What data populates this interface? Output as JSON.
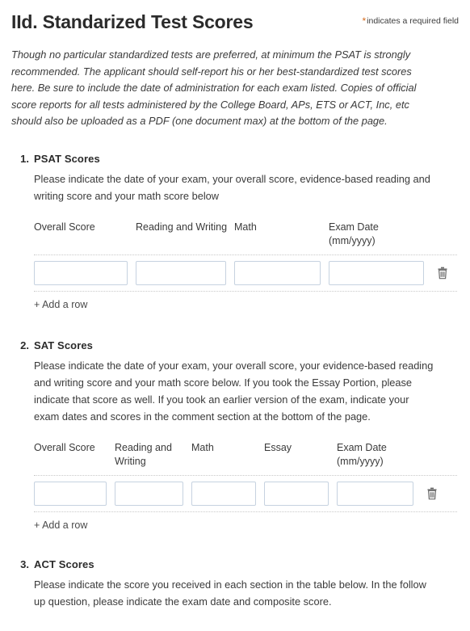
{
  "header": {
    "title": "IId. Standarized Test Scores",
    "required_note_star": "*",
    "required_note_text": "indicates a required field"
  },
  "intro": "Though no particular standardized tests are preferred, at minimum the PSAT is strongly recommended. The applicant should self-report his or her best-standardized test scores here. Be sure to include the date of administration for each exam listed. Copies of official score reports for all tests administered by the College Board, APs, ETS or ACT, Inc, etc should also be uploaded as a PDF (one document max) at the bottom of the page.",
  "questions": [
    {
      "number": "1.",
      "title": "PSAT Scores",
      "description": "Please indicate the date of your exam, your overall score, evidence-based reading and writing score and your math score below",
      "columns": [
        "Overall Score",
        "Reading and Writing",
        "Math",
        "Exam Date (mm/yyyy)"
      ],
      "row_values": [
        "",
        "",
        "",
        ""
      ],
      "delete_icon": "trash-icon",
      "add_row_label": "+ Add a row"
    },
    {
      "number": "2.",
      "title": "SAT Scores",
      "description": "Please indicate the date of your exam, your overall score, your evidence-based reading and writing score and your math score below. If you took the Essay Portion, please indicate that score as well. If you took an earlier version of the exam, indicate your exam dates and scores in the comment section at the bottom of the page.",
      "columns": [
        "Overall Score",
        "Reading and Writing",
        "Math",
        "Essay",
        "Exam Date (mm/yyyy)"
      ],
      "row_values": [
        "",
        "",
        "",
        "",
        ""
      ],
      "delete_icon": "trash-icon",
      "add_row_label": "+ Add a row"
    },
    {
      "number": "3.",
      "title": "ACT Scores",
      "description": "Please indicate the score you received in each section in the table below. In the follow up question, please indicate the exam date and composite score."
    }
  ],
  "colors": {
    "accent_star": "#d46a1b",
    "input_border": "#c6d2e0",
    "divider": "#c9c9c9",
    "text": "#3a3a3a",
    "heading": "#2b2b2b"
  }
}
